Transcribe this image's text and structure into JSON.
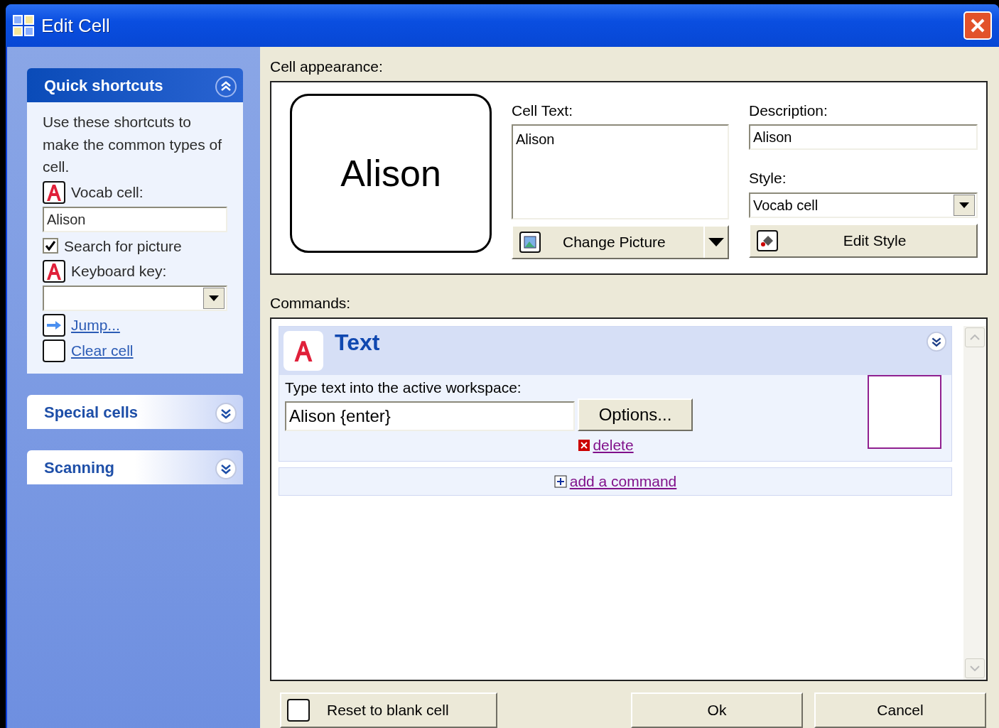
{
  "window": {
    "title": "Edit Cell"
  },
  "sidebar": {
    "groups": [
      {
        "title": "Quick shortcuts",
        "expanded": true,
        "items": [
          {
            "kind": "text",
            "text": "Use these shortcuts to make the common types of cell."
          },
          {
            "kind": "label",
            "text": "Vocab cell:"
          },
          {
            "kind": "input",
            "value": "Alison"
          },
          {
            "kind": "checkbox",
            "text": "Search for picture",
            "checked": true
          },
          {
            "kind": "label",
            "text": "Keyboard key:"
          },
          {
            "kind": "select"
          },
          {
            "kind": "jump_link",
            "text": "Jump..."
          },
          {
            "kind": "clear_link",
            "text": "Clear cell"
          }
        ]
      },
      {
        "title": "Special cells",
        "expanded": false
      },
      {
        "title": "Scanning",
        "expanded": false
      }
    ]
  },
  "appearance": {
    "label": "Cell appearance:",
    "preview_text": "Alison",
    "cell_text_label": "Cell Text:",
    "cell_text": "Alison",
    "description_label": "Description:",
    "description": "Alison",
    "style_label": "Style:",
    "style": "Vocab cell",
    "change_picture": "Change Picture",
    "edit_style": "Edit Style"
  },
  "commands": {
    "label": "Commands:",
    "items": [
      {
        "title": "Text",
        "prompt": "Type text into the active workspace:",
        "value": "Alison {enter}",
        "options": "Options...",
        "delete": "delete"
      }
    ],
    "add": "add a command"
  },
  "buttons": {
    "reset": "Reset to blank cell",
    "ok": "Ok",
    "cancel": "Cancel"
  }
}
